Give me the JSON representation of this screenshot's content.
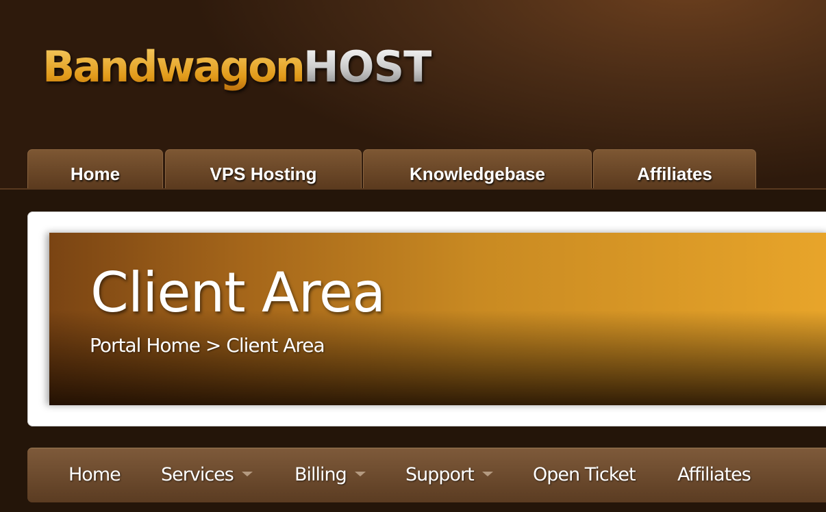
{
  "logo": {
    "part1": "Bandwagon",
    "part2": "HOST"
  },
  "top_tabs": [
    {
      "label": "Home"
    },
    {
      "label": "VPS Hosting"
    },
    {
      "label": "Knowledgebase"
    },
    {
      "label": "Affiliates"
    }
  ],
  "banner": {
    "title": "Client Area",
    "breadcrumb": "Portal Home > Client Area"
  },
  "nav": [
    {
      "label": "Home",
      "has_dropdown": false
    },
    {
      "label": "Services",
      "has_dropdown": true
    },
    {
      "label": "Billing",
      "has_dropdown": true
    },
    {
      "label": "Support",
      "has_dropdown": true
    },
    {
      "label": "Open Ticket",
      "has_dropdown": false
    },
    {
      "label": "Affiliates",
      "has_dropdown": false
    }
  ],
  "colors": {
    "accent_gold": "#e9a92c",
    "tab_brown": "#6a4728",
    "background": "#241509"
  },
  "icons": {
    "dropdown": "chevron-down-icon"
  }
}
